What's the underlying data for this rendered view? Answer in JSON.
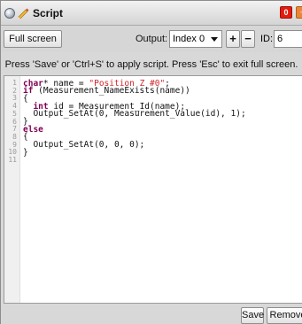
{
  "window": {
    "title": "Script",
    "close_label": "0"
  },
  "toolbar": {
    "fullscreen_label": "Full screen",
    "output_label": "Output:",
    "output_value": "Index 0",
    "plus_label": "+",
    "minus_label": "−",
    "id_label": "ID:",
    "id_value": "6"
  },
  "hint": "Press 'Save' or 'Ctrl+S' to apply script. Press 'Esc' to exit full screen.",
  "editor": {
    "line_numbers": [
      "1",
      "2",
      "3",
      "4",
      "5",
      "6",
      "7",
      "8",
      "9",
      "10",
      "11"
    ],
    "lines": [
      "char* name = \"Position Z #0\";",
      "if (Measurement_NameExists(name))",
      "{",
      "  int id = Measurement_Id(name);",
      "  Output_SetAt(0, Measurement_Value(id), 1);",
      "}",
      "else",
      "{",
      "  Output_SetAt(0, 0, 0);",
      "}",
      ""
    ]
  },
  "footer": {
    "save_label": "Save",
    "remove_label": "Remove"
  },
  "colors": {
    "keyword": "#7f0055",
    "string": "#d6262b",
    "close_button": "#e21d10"
  }
}
